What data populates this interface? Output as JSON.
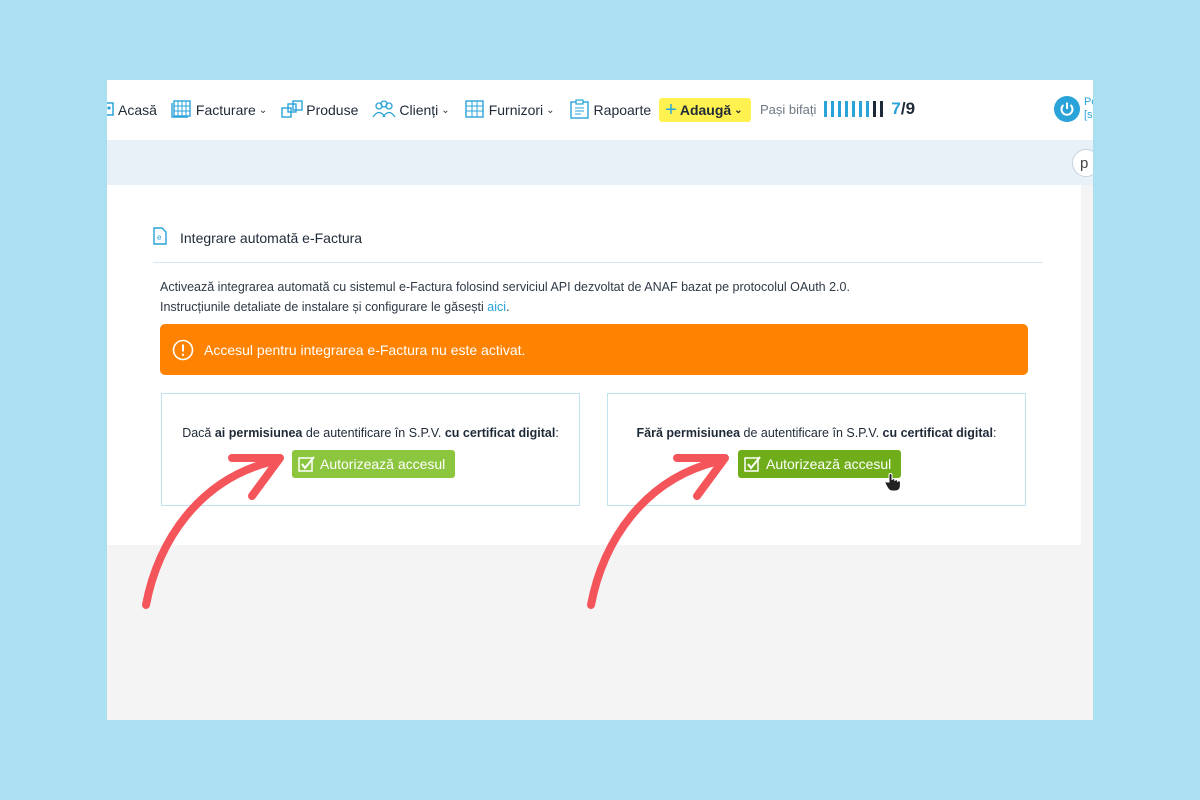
{
  "nav": {
    "items": [
      {
        "label": "Acasă",
        "icon": "home-icon",
        "dropdown": false
      },
      {
        "label": "Facturare",
        "icon": "invoice-icon",
        "dropdown": true
      },
      {
        "label": "Produse",
        "icon": "products-icon",
        "dropdown": false
      },
      {
        "label": "Clienți",
        "icon": "clients-icon",
        "dropdown": true
      },
      {
        "label": "Furnizori",
        "icon": "suppliers-icon",
        "dropdown": true
      },
      {
        "label": "Rapoarte",
        "icon": "reports-icon",
        "dropdown": false
      }
    ],
    "add_label": "Adaugă",
    "add_icon": "plus-icon"
  },
  "steps": {
    "label": "Pași bifați",
    "done": 7,
    "total": 9,
    "done_text": "7",
    "total_text": "9",
    "separator": "/"
  },
  "user": {
    "line1": "Po",
    "line2": "[s"
  },
  "subbar": {
    "search_letter": "p"
  },
  "card": {
    "title": "Integrare automată e-Factura",
    "desc_line1": "Activează integrarea automată cu sistemul e-Factura folosind serviciul API dezvoltat de ANAF bazat pe protocolul OAuth 2.0.",
    "desc_line2": "Instrucțiunile detaliate de instalare și configurare le găsești",
    "desc_link": "aici",
    "desc_end": "."
  },
  "alert": {
    "text": "Accesul pentru integrarea e-Factura nu este activat.",
    "color": "#ff8200"
  },
  "options": [
    {
      "pre": "Dacă ",
      "bold1": "ai permisiunea",
      "mid": " de autentificare în S.P.V. ",
      "bold2": "cu certificat digital",
      "post": ":",
      "button": "Autorizează accesul"
    },
    {
      "pre": "",
      "bold1": "Fără permisiunea",
      "mid": " de autentificare în S.P.V. ",
      "bold2": "cu certificat digital",
      "post": ":",
      "button": "Autorizează accesul"
    }
  ],
  "colors": {
    "background": "#abdff2",
    "accent": "#2aa3d8",
    "button_green": "#8cc63f",
    "button_green_hover": "#6fae1a",
    "arrow": "#f4555a",
    "highlight": "#fff14f"
  }
}
